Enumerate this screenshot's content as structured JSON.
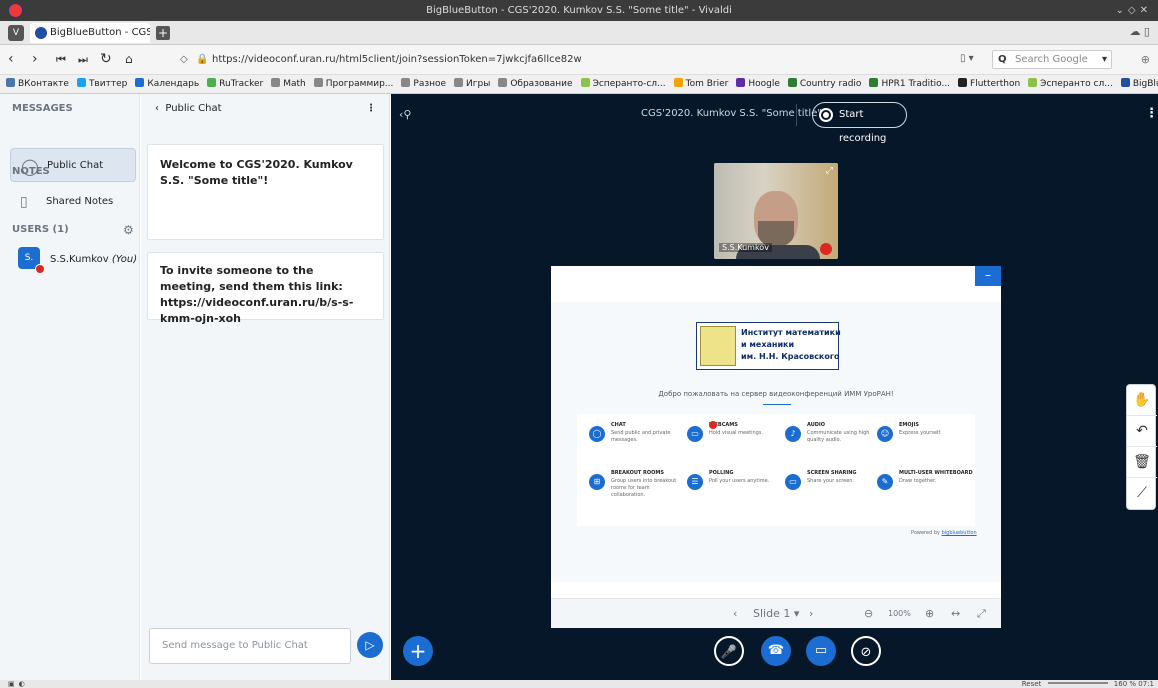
{
  "window": {
    "title": "BigBlueButton - CGS'2020. Kumkov S.S. \"Some title\" - Vivaldi"
  },
  "tab": {
    "label": "BigBlueButton - CGS'2020."
  },
  "address": {
    "url": "https://videoconf.uran.ru/html5client/join?sessionToken=7jwkcjfa6llce82w",
    "search_placeholder": "Search Google"
  },
  "bookmarks": [
    {
      "label": "ВКонтакте",
      "color": "#4a76a8"
    },
    {
      "label": "Твиттер",
      "color": "#1da1f2"
    },
    {
      "label": "Календарь",
      "color": "#1b6dd1"
    },
    {
      "label": "RuTracker",
      "color": "#4caf50"
    },
    {
      "label": "Math",
      "color": "#888888"
    },
    {
      "label": "Программир...",
      "color": "#888888"
    },
    {
      "label": "Разное",
      "color": "#888888"
    },
    {
      "label": "Игры",
      "color": "#888888"
    },
    {
      "label": "Образование",
      "color": "#888888"
    },
    {
      "label": "Эсперанто-сл...",
      "color": "#8bc34a"
    },
    {
      "label": "Tom Brier",
      "color": "#f4a300"
    },
    {
      "label": "Hoogle",
      "color": "#5e2ca5"
    },
    {
      "label": "Country radio",
      "color": "#2e7d32"
    },
    {
      "label": "HPR1 Traditio...",
      "color": "#2e7d32"
    },
    {
      "label": "Flutterthon",
      "color": "#222222"
    },
    {
      "label": "Эсперанто сл...",
      "color": "#8bc34a"
    },
    {
      "label": "BigBlueButton",
      "color": "#1e4fa3"
    }
  ],
  "sidebar": {
    "messages_heading": "MESSAGES",
    "public_chat": "Public Chat",
    "notes_heading": "NOTES",
    "shared_notes": "Shared Notes",
    "users_heading": "USERS (1)",
    "user_initials": "S.",
    "user_name": "S.S.Kumkov",
    "user_you": "(You)"
  },
  "chat": {
    "header": "Public Chat",
    "messages": [
      "Welcome to CGS'2020. Kumkov S.S. \"Some title\"!",
      "To invite someone to the meeting, send them this link: https://videoconf.uran.ru/b/s-s-kmm-ojn-xoh"
    ],
    "input_placeholder": "Send message to Public Chat"
  },
  "meeting": {
    "title": "CGS'2020. Kumkov S.S. \"Some title\"",
    "record_label": "Start recording",
    "webcam_name": "S.S.Kumkov"
  },
  "presentation": {
    "logo_line1": "Институт математики",
    "logo_line2": "и механики",
    "logo_line3": "им. Н.Н. Красовского",
    "welcome": "Добро пожаловать на сервер видеоконференций ИММ УроРАН!",
    "features": [
      {
        "title": "CHAT",
        "desc": "Send public and private messages."
      },
      {
        "title": "WEBCAMS",
        "desc": "Hold visual meetings."
      },
      {
        "title": "AUDIO",
        "desc": "Communicate using high quality audio."
      },
      {
        "title": "EMOJIS",
        "desc": "Express yourself."
      },
      {
        "title": "BREAKOUT ROOMS",
        "desc": "Group users into breakout rooms for team collaboration."
      },
      {
        "title": "POLLING",
        "desc": "Poll your users anytime."
      },
      {
        "title": "SCREEN SHARING",
        "desc": "Share your screen."
      },
      {
        "title": "MULTI-USER WHITEBOARD",
        "desc": "Draw together."
      }
    ],
    "powered_prefix": "Powered by",
    "powered_link": "bigbluebutton",
    "slide_label": "Slide 1",
    "zoom": "100%"
  },
  "statusbar": {
    "reset": "Reset",
    "zoom": "160 %",
    "time": "07:1"
  }
}
